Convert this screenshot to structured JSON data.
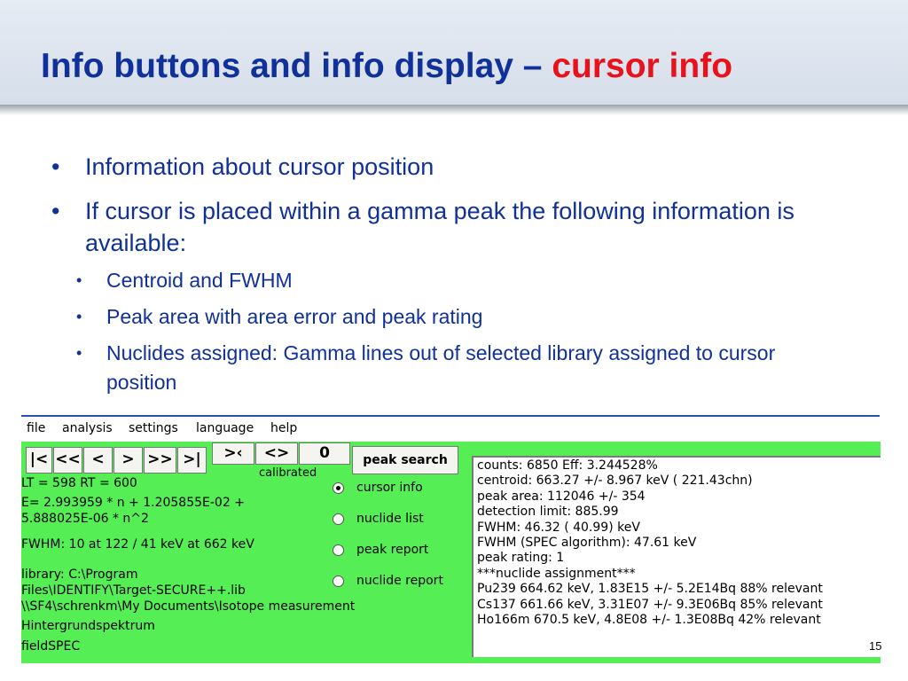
{
  "slide": {
    "title_main": "Info buttons and info display – ",
    "title_accent": "cursor info",
    "bullets": [
      "Information about cursor position",
      "If cursor is placed within a gamma peak the following information is available:"
    ],
    "sub_bullets": [
      "Centroid and FWHM",
      "Peak area with area error and peak rating",
      "Nuclides assigned: Gamma lines out of selected library assigned to cursor position"
    ],
    "page_number": "15",
    "colors": {
      "title": "#10309a",
      "accent": "#e8121c",
      "app_bg": "#55ef55"
    }
  },
  "app": {
    "menu": [
      "file",
      "analysis",
      "settings",
      "language",
      "help"
    ],
    "nav_buttons": [
      "|<",
      "<<",
      "<",
      ">",
      ">>",
      ">|"
    ],
    "zoom_buttons": [
      ">‹",
      "<>",
      "0"
    ],
    "calibrated_label": "calibrated",
    "peak_search_label": "peak search",
    "left_info": [
      "LT =  598 RT =  600",
      "E= 2.993959 * n + 1.205855E-02 +",
      "5.888025E-06 * n^2",
      "FWHM:  10 at  122 /  41 keV at  662 keV",
      "library: C:\\Program",
      "Files\\IDENTIFY\\Target-SECURE++.lib",
      "\\\\SF4\\schrenkm\\My Documents\\Isotope measurement",
      "Hintergrundspektrum",
      "fieldSPEC"
    ],
    "radio_options": [
      {
        "label": "cursor info",
        "selected": true
      },
      {
        "label": "nuclide list",
        "selected": false
      },
      {
        "label": "peak report",
        "selected": false
      },
      {
        "label": "nuclide report",
        "selected": false
      }
    ],
    "info_panel": [
      "counts:  6850 Eff:  3.244528%",
      "centroid:  663.27 +/- 8.967 keV ( 221.43chn)",
      "peak area:  112046 +/- 354",
      "detection limit: 885.99",
      "FWHM:  46.32 ( 40.99) keV",
      "FWHM (SPEC algorithm):  47.61 keV",
      "peak rating: 1",
      "***nuclide assignment***",
      "Pu239   664.62 keV, 1.83E15 +/- 5.2E14Bq  88% relevant",
      "Cs137   661.66 keV, 3.31E07 +/- 9.3E06Bq  85% relevant",
      "Ho166m  670.5 keV, 4.8E08 +/- 1.3E08Bq  42% relevant"
    ]
  }
}
